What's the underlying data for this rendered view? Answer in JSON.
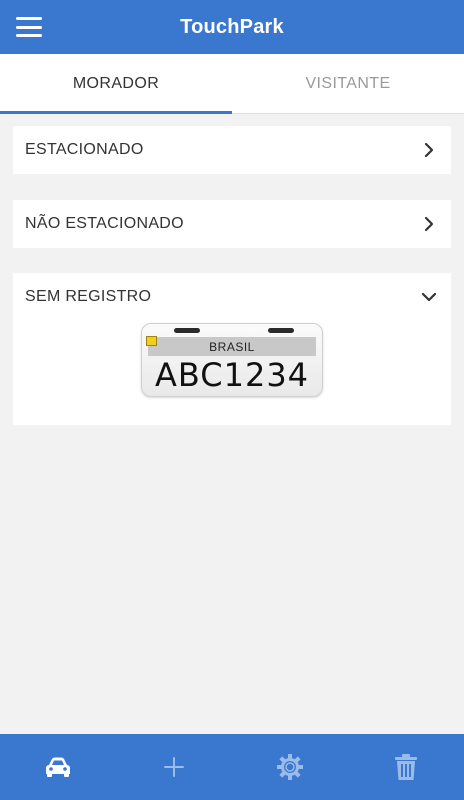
{
  "header": {
    "title": "TouchPark",
    "menu_icon": "hamburger-icon"
  },
  "tabs": [
    {
      "label": "MORADOR",
      "active": true
    },
    {
      "label": "VISITANTE",
      "active": false
    }
  ],
  "sections": [
    {
      "label": "ESTACIONADO",
      "icon": "chevron-right-icon",
      "expanded": false
    },
    {
      "label": "NÃO ESTACIONADO",
      "icon": "chevron-right-icon",
      "expanded": false
    },
    {
      "label": "SEM REGISTRO",
      "icon": "chevron-down-icon",
      "expanded": true
    }
  ],
  "plate": {
    "country": "BRASIL",
    "number": "ABC1234"
  },
  "bottom_nav": [
    {
      "icon": "car-icon",
      "active": true
    },
    {
      "icon": "plus-icon",
      "active": false
    },
    {
      "icon": "gear-icon",
      "active": false
    },
    {
      "icon": "trash-icon",
      "active": false
    }
  ],
  "colors": {
    "accent": "#3a78d0",
    "background": "#f2f2f2",
    "inactive_icon": "#9bbbe8"
  }
}
